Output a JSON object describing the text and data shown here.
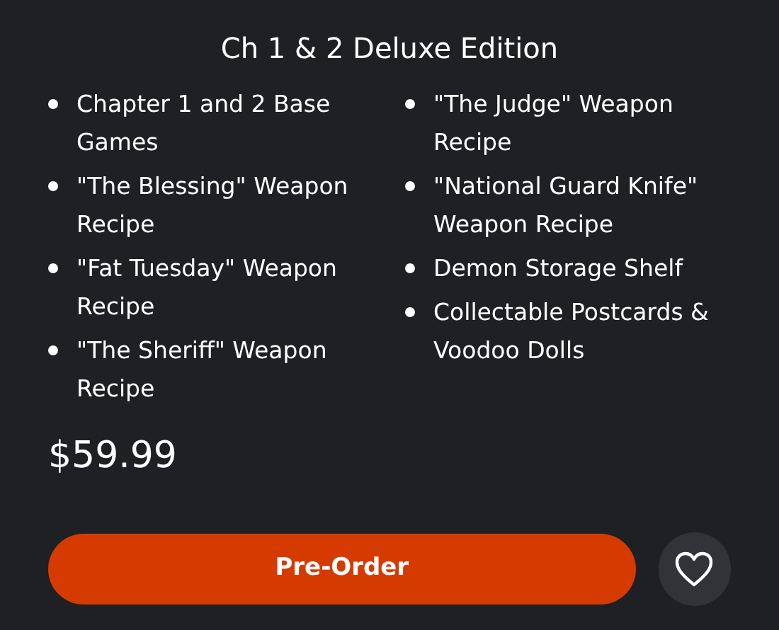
{
  "title": "Ch 1 & 2 Deluxe Edition",
  "columns": [
    [
      "Chapter 1 and 2 Base Games",
      "\"The Blessing\" Weapon Recipe",
      "\"Fat Tuesday\" Weapon Recipe",
      "\"The Sheriff\" Weapon Recipe"
    ],
    [
      "\"The Judge\" Weapon Recipe",
      "\"National Guard Knife\" Weapon Recipe",
      "Demon Storage Shelf",
      "Collectable Postcards & Voodoo Dolls"
    ]
  ],
  "price": "$59.99",
  "button": {
    "label": "Pre-Order"
  }
}
